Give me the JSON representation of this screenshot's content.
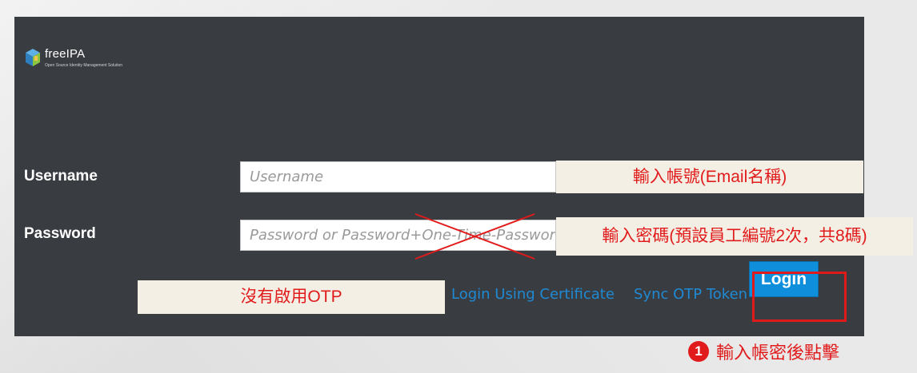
{
  "app": {
    "name": "freeIPA",
    "tagline": "Open Source Identity Management Solution"
  },
  "form": {
    "username_label": "Username",
    "username_placeholder": "Username",
    "password_label": "Password",
    "password_placeholder": "Password or Password+One-Time-Password",
    "cert_link": "Login Using Certificate",
    "otp_link": "Sync OTP Token",
    "login_button": "Login"
  },
  "annotations": {
    "username_note": "輸入帳號(Email名稱)",
    "password_note": "輸入密碼(預設員工編號2次，共8碼)",
    "otp_note": "沒有啟用OTP",
    "step_number": "1",
    "step_text": "輸入帳密後點擊"
  },
  "colors": {
    "panel_bg": "#393c40",
    "link": "#1f8ad3",
    "button": "#0f8fdb",
    "annotation_red": "#e11b1b"
  }
}
